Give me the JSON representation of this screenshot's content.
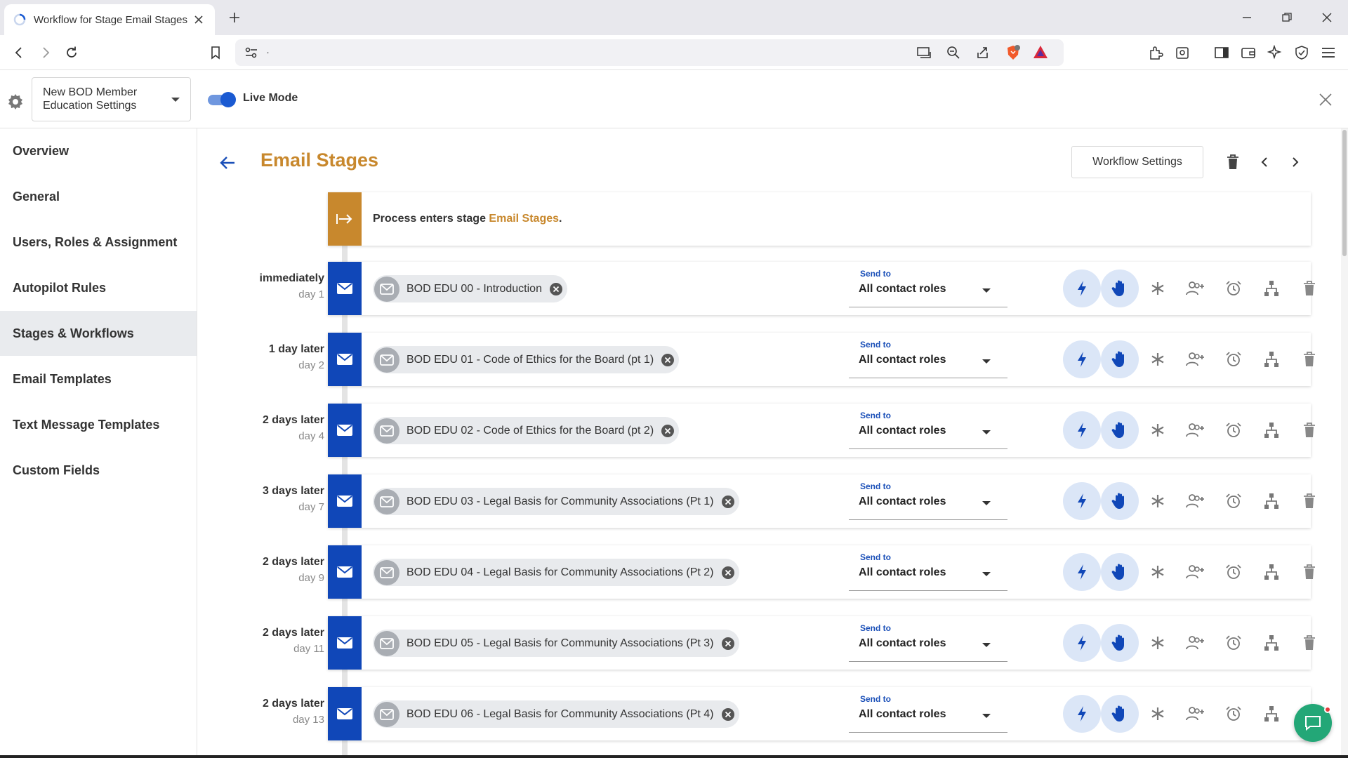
{
  "browser": {
    "tab_title": "Workflow for Stage Email Stages",
    "url": "·"
  },
  "header": {
    "workflow_select": "New BOD Member Education Settings",
    "live_mode_label": "Live Mode",
    "live_mode_on": true
  },
  "sidebar": {
    "items": [
      {
        "label": "Overview",
        "active": false
      },
      {
        "label": "General",
        "active": false
      },
      {
        "label": "Users, Roles & Assignment",
        "active": false
      },
      {
        "label": "Autopilot Rules",
        "active": false
      },
      {
        "label": "Stages & Workflows",
        "active": true
      },
      {
        "label": "Email Templates",
        "active": false
      },
      {
        "label": "Text Message Templates",
        "active": false
      },
      {
        "label": "Custom Fields",
        "active": false
      }
    ]
  },
  "main": {
    "title": "Email Stages",
    "workflow_settings_label": "Workflow Settings",
    "enter_text_prefix": "Process enters stage ",
    "enter_stage_name": "Email Stages",
    "enter_text_suffix": ".",
    "send_to_label": "Send to",
    "stages": [
      {
        "delay": "immediately",
        "day": "day 1",
        "template": "BOD EDU 00 - Introduction",
        "send_to": "All contact roles"
      },
      {
        "delay": "1 day later",
        "day": "day 2",
        "template": "BOD EDU 01 - Code of Ethics for the Board (pt 1)",
        "send_to": "All contact roles"
      },
      {
        "delay": "2 days later",
        "day": "day 4",
        "template": "BOD EDU 02 - Code of Ethics for the Board (pt 2)",
        "send_to": "All contact roles"
      },
      {
        "delay": "3 days later",
        "day": "day 7",
        "template": "BOD EDU 03 - Legal Basis for Community Associations (Pt 1)",
        "send_to": "All contact roles"
      },
      {
        "delay": "2 days later",
        "day": "day 9",
        "template": "BOD EDU 04 - Legal Basis for Community Associations (Pt 2)",
        "send_to": "All contact roles"
      },
      {
        "delay": "2 days later",
        "day": "day 11",
        "template": "BOD EDU 05 - Legal Basis for Community Associations (Pt 3)",
        "send_to": "All contact roles"
      },
      {
        "delay": "2 days later",
        "day": "day 13",
        "template": "BOD EDU 06 - Legal Basis for Community Associations (Pt 4)",
        "send_to": "All contact roles"
      }
    ],
    "row_actions": [
      "lightning-icon",
      "hand-icon",
      "asterisk-icon",
      "add-person-icon",
      "alarm-clock-icon",
      "hierarchy-icon",
      "trash-icon"
    ]
  },
  "colors": {
    "accent_gold": "#c8882d",
    "stage_blue": "#1047b8",
    "action_bg": "#dbe6f7",
    "chat_green": "#23a777"
  }
}
